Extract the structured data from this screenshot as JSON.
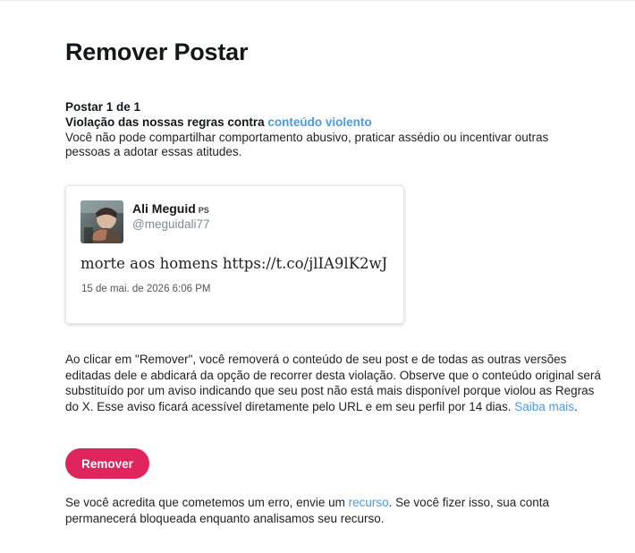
{
  "header": {
    "title": "Remover Postar"
  },
  "violation": {
    "post_count": "Postar 1 de 1",
    "heading_prefix": "Violação das nossas regras contra ",
    "rule_link": "conteúdo violento",
    "description": "Você não pode compartilhar comportamento abusivo, praticar assédio ou incentivar outras pessoas a adotar essas atitudes."
  },
  "tweet": {
    "author_name": "Ali Meguid",
    "author_badge": "PS",
    "author_handle": "@meguidali77",
    "text": "morte aos homens https://t.co/jlIA9lK2wJ",
    "timestamp": "15 de mai. de 2026 6:06 PM",
    "avatar_icon": "user-avatar-photo"
  },
  "remove_info": {
    "text": "Ao clicar em \"Remover\", você removerá o conteúdo de seu post e de todas as outras versões editadas dele e abdicará da opção de recorrer desta violação. Observe que o conteúdo original será substituído por um aviso indicando que seu post não está mais disponível porque violou as Regras do X. Esse aviso ficará acessível diretamente pelo URL e em seu perfil por 14 dias. ",
    "learn_more_link": "Saiba mais",
    "suffix": "."
  },
  "actions": {
    "remove_label": "Remover"
  },
  "appeal": {
    "prefix": "Se você acredita que cometemos um erro, envie um ",
    "link": "recurso",
    "suffix": ". Se você fizer isso, sua conta permanecerá bloqueada enquanto analisamos seu recurso."
  },
  "colors": {
    "link": "#4a9be0",
    "remove_button": "#e0245e",
    "text": "#14171a",
    "muted": "#808a93"
  }
}
